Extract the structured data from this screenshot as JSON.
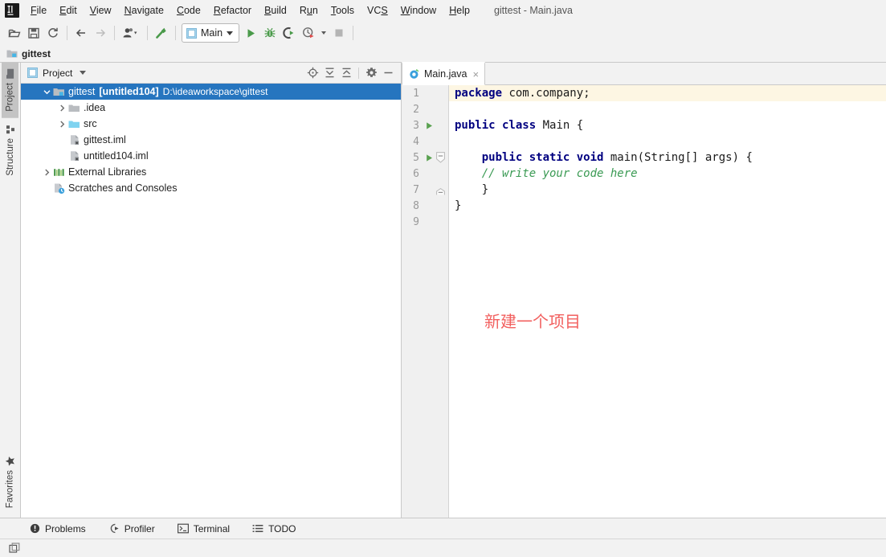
{
  "window": {
    "title": "gittest - Main.java",
    "app_logo_icon": "intellij-idea-logo"
  },
  "menubar": {
    "items": [
      {
        "label": "File",
        "mnemonic": "F"
      },
      {
        "label": "Edit",
        "mnemonic": "E"
      },
      {
        "label": "View",
        "mnemonic": "V"
      },
      {
        "label": "Navigate",
        "mnemonic": "N"
      },
      {
        "label": "Code",
        "mnemonic": "C"
      },
      {
        "label": "Refactor",
        "mnemonic": "R"
      },
      {
        "label": "Build",
        "mnemonic": "B"
      },
      {
        "label": "Run",
        "mnemonic": "u"
      },
      {
        "label": "Tools",
        "mnemonic": "T"
      },
      {
        "label": "VCS",
        "mnemonic": "S"
      },
      {
        "label": "Window",
        "mnemonic": "W"
      },
      {
        "label": "Help",
        "mnemonic": "H"
      }
    ]
  },
  "toolbar": {
    "buttons": [
      {
        "name": "open-folder-icon",
        "tooltip": "Open"
      },
      {
        "name": "save-all-icon",
        "tooltip": "Save All"
      },
      {
        "name": "sync-refresh-icon",
        "tooltip": "Synchronize"
      },
      {
        "name": "back-arrow-icon",
        "tooltip": "Back"
      },
      {
        "name": "forward-arrow-icon",
        "tooltip": "Forward"
      },
      {
        "name": "profile-dropdown-icon",
        "tooltip": "User"
      },
      {
        "name": "build-hammer-icon",
        "tooltip": "Build Project"
      }
    ],
    "run_config": {
      "label": "Main",
      "icon": "run-config-icon"
    },
    "run_buttons": [
      {
        "name": "run-icon",
        "tooltip": "Run"
      },
      {
        "name": "debug-bug-icon",
        "tooltip": "Debug"
      },
      {
        "name": "run-coverage-icon",
        "tooltip": "Run with Coverage"
      },
      {
        "name": "profile-clock-icon",
        "tooltip": "Profile"
      },
      {
        "name": "stop-icon",
        "tooltip": "Stop"
      }
    ]
  },
  "navbar": {
    "breadcrumb": "gittest",
    "icon": "module-folder-icon"
  },
  "stripe": {
    "top_tabs": [
      {
        "label": "Project",
        "icon": "project-folder-icon",
        "active": true
      },
      {
        "label": "Structure",
        "icon": "structure-icon",
        "active": false
      }
    ],
    "bottom_tabs": [
      {
        "label": "Favorites",
        "icon": "star-icon",
        "active": false
      }
    ]
  },
  "project_panel": {
    "title": "Project",
    "view_icon": "project-view-icon",
    "actions": [
      {
        "name": "scroll-to-source-icon",
        "tooltip": "Select Opened File"
      },
      {
        "name": "expand-all-icon",
        "tooltip": "Expand All"
      },
      {
        "name": "collapse-all-icon",
        "tooltip": "Collapse All"
      },
      {
        "name": "settings-gear-icon",
        "tooltip": "Options"
      },
      {
        "name": "hide-minimize-icon",
        "tooltip": "Hide"
      }
    ],
    "tree": [
      {
        "label": "gittest",
        "bracket": "[untitled104]",
        "path": "D:\\ideaworkspace\\gittest",
        "icon": "module-folder-icon",
        "indent": 0,
        "arrow": "expanded",
        "selected": true
      },
      {
        "label": ".idea",
        "icon": "folder-grey-icon",
        "indent": 1,
        "arrow": "collapsed",
        "selected": false
      },
      {
        "label": "src",
        "icon": "folder-source-icon",
        "indent": 1,
        "arrow": "collapsed",
        "selected": false
      },
      {
        "label": "gittest.iml",
        "icon": "iml-file-icon",
        "indent": 1,
        "arrow": "none",
        "selected": false
      },
      {
        "label": "untitled104.iml",
        "icon": "iml-file-icon",
        "indent": 1,
        "arrow": "none",
        "selected": false
      },
      {
        "label": "External Libraries",
        "icon": "libraries-icon",
        "indent": 0,
        "arrow": "collapsed",
        "selected": false
      },
      {
        "label": "Scratches and Consoles",
        "icon": "scratches-icon",
        "indent": 0,
        "arrow": "none",
        "selected": false
      }
    ]
  },
  "editor": {
    "tabs": [
      {
        "label": "Main.java",
        "icon": "java-class-icon",
        "active": true,
        "close_icon": "close-icon",
        "close_glyph": "×"
      }
    ],
    "lines": [
      {
        "num": "1",
        "run_marker": false,
        "fold": "none",
        "caret": true,
        "tokens": [
          {
            "t": "package",
            "c": "kw"
          },
          {
            "t": " com.company;",
            "c": "pl"
          }
        ]
      },
      {
        "num": "2",
        "run_marker": false,
        "fold": "none",
        "caret": false,
        "tokens": []
      },
      {
        "num": "3",
        "run_marker": true,
        "fold": "none",
        "caret": false,
        "tokens": [
          {
            "t": "public class",
            "c": "kw"
          },
          {
            "t": " Main {",
            "c": "pl"
          }
        ]
      },
      {
        "num": "4",
        "run_marker": false,
        "fold": "none",
        "caret": false,
        "tokens": []
      },
      {
        "num": "5",
        "run_marker": true,
        "fold": "start",
        "caret": false,
        "tokens": [
          {
            "t": "    ",
            "c": "pl"
          },
          {
            "t": "public static void",
            "c": "kw"
          },
          {
            "t": " main(String[] args) {",
            "c": "pl"
          }
        ]
      },
      {
        "num": "6",
        "run_marker": false,
        "fold": "none",
        "caret": false,
        "tokens": [
          {
            "t": "    ",
            "c": "pl"
          },
          {
            "t": "// write your code here",
            "c": "cm"
          }
        ]
      },
      {
        "num": "7",
        "run_marker": false,
        "fold": "end",
        "caret": false,
        "tokens": [
          {
            "t": "    }",
            "c": "pl"
          }
        ]
      },
      {
        "num": "8",
        "run_marker": false,
        "fold": "none",
        "caret": false,
        "tokens": [
          {
            "t": "}",
            "c": "pl"
          }
        ]
      },
      {
        "num": "9",
        "run_marker": false,
        "fold": "none",
        "caret": false,
        "tokens": []
      }
    ],
    "annotation": {
      "text": "新建一个项目",
      "color": "#f2605f"
    }
  },
  "bottom_bar": {
    "items": [
      {
        "label": "Problems",
        "icon": "problems-icon"
      },
      {
        "label": "Profiler",
        "icon": "profiler-icon"
      },
      {
        "label": "Terminal",
        "icon": "terminal-icon"
      },
      {
        "label": "TODO",
        "icon": "todo-list-icon"
      }
    ]
  },
  "status_bar": {
    "left_icon": "layout-toggle-icon"
  },
  "colors": {
    "selection_blue": "#2675bf",
    "caret_line": "#fdf6e3",
    "keyword": "#000080",
    "comment_green": "#3a9a53",
    "annotation_red": "#f2605f",
    "chrome": "#f2f2f2"
  }
}
